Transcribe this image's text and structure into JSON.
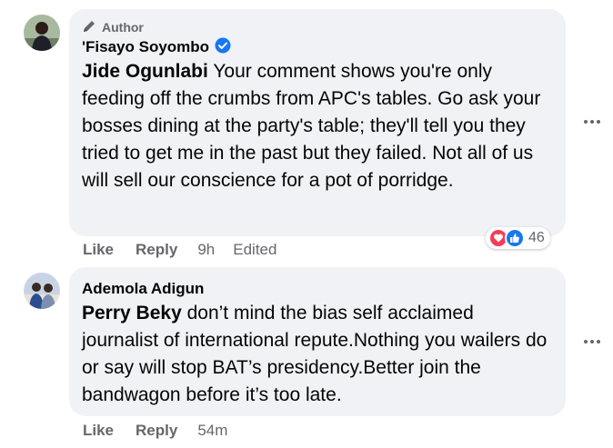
{
  "comments": [
    {
      "author_badge": "Author",
      "name": "'Fisayo Soyombo",
      "verified": true,
      "mention": "Jide Ogunlabi",
      "text": " Your comment shows you're only feeding off the crumbs from APC's tables. Go ask your bosses dining at the party's table; they'll tell you they tried to get me in the past but they failed. Not all of us will sell our conscience for a pot of porridge.",
      "like_label": "Like",
      "reply_label": "Reply",
      "time": "9h",
      "edited": "Edited",
      "reaction_count": "46",
      "reactions": [
        "love-icon",
        "like-icon"
      ]
    },
    {
      "name": "Ademola Adigun",
      "mention": "Perry Beky",
      "text": " don’t mind the bias self acclaimed journalist of international repute.Nothing you wailers do or say will stop BAT’s presidency.Better join the bandwagon before it’s too late.",
      "like_label": "Like",
      "reply_label": "Reply",
      "time": "54m"
    }
  ],
  "colors": {
    "bubble": "#f0f2f5",
    "meta_text": "#65676b",
    "verified": "#1877f2",
    "love": "#f33e58",
    "like": "#1877f2"
  }
}
